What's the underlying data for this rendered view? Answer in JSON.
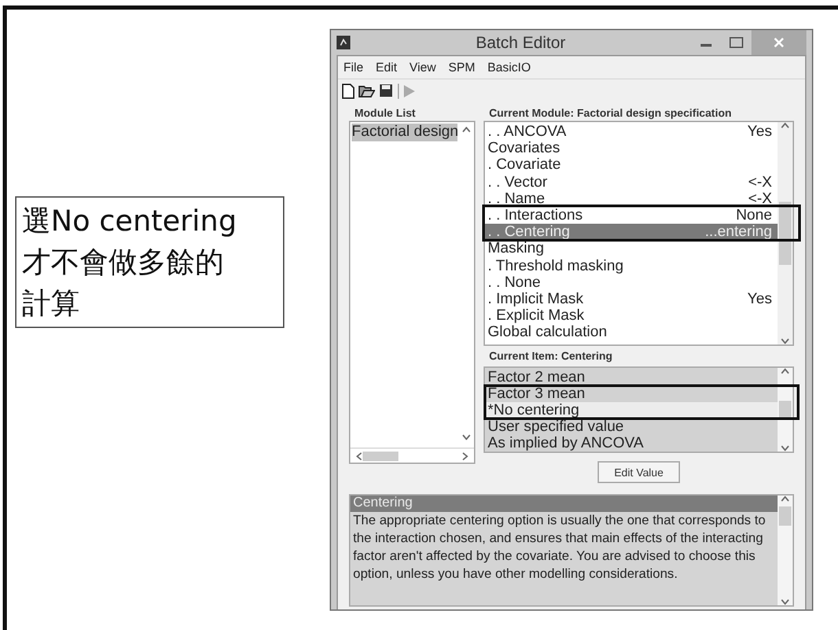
{
  "callout": {
    "lines": [
      "選No centering",
      "才不會做多餘的",
      "計算"
    ]
  },
  "window": {
    "title": "Batch Editor"
  },
  "menu": [
    "File",
    "Edit",
    "View",
    "SPM",
    "BasicIO"
  ],
  "module_list": {
    "label": "Module List",
    "items": [
      {
        "text": "Factorial design",
        "selected": true
      }
    ]
  },
  "current_module": {
    "label": "Current Module: Factorial design specification",
    "rows": [
      {
        "text": ". . ANCOVA",
        "value": "Yes",
        "selected": false
      },
      {
        "text": "Covariates",
        "selected": false
      },
      {
        "text": ". Covariate",
        "selected": false
      },
      {
        "text": ". . Vector",
        "value": "<-X",
        "selected": false
      },
      {
        "text": ". . Name",
        "value": "<-X",
        "selected": false
      },
      {
        "text": ". . Interactions",
        "value": "None",
        "selected": false
      },
      {
        "text": ". . Centering",
        "value": "...entering",
        "selected": true
      },
      {
        "text": "Masking",
        "selected": false
      },
      {
        "text": ". Threshold masking",
        "selected": false
      },
      {
        "text": ". . None",
        "selected": false
      },
      {
        "text": ". Implicit Mask",
        "value": "Yes",
        "selected": false
      },
      {
        "text": ". Explicit Mask",
        "selected": false
      },
      {
        "text": "Global calculation",
        "selected": false
      }
    ]
  },
  "current_item": {
    "label": "Current Item: Centering",
    "options": [
      {
        "text": "Factor 2 mean",
        "selected": false
      },
      {
        "text": "Factor 3 mean",
        "selected": false
      },
      {
        "text": "*No centering",
        "selected": true
      },
      {
        "text": "User specified value",
        "selected": false
      },
      {
        "text": "As implied by ANCOVA",
        "selected": false
      }
    ]
  },
  "edit_button": "Edit Value",
  "help": {
    "title": "Centering",
    "text": "The  appropriate centering option is usually the one that corresponds to the  interaction  chosen, and ensures that main effects of the interacting factor  aren't  affected  by the covariate. You are advised to choose this option, unless you have other modelling considerations."
  }
}
